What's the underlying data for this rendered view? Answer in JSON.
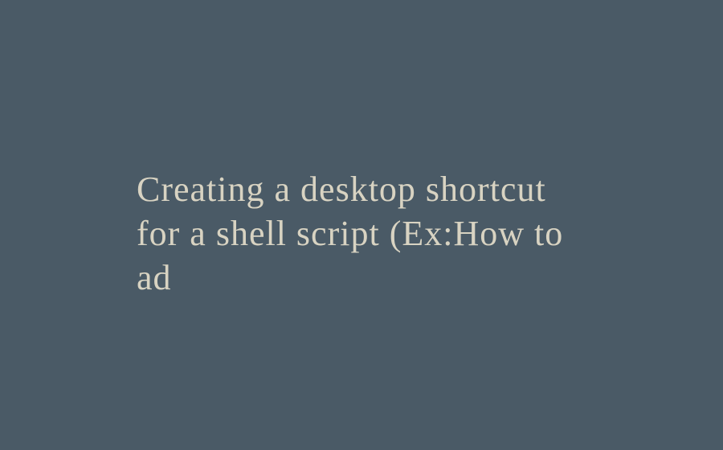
{
  "main": {
    "text": "Creating a desktop shortcut for a shell script (Ex:How to ad"
  }
}
